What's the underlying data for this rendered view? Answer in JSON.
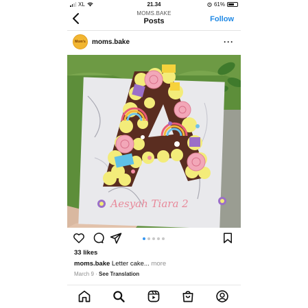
{
  "status_bar": {
    "carrier": "XL",
    "time": "21.34",
    "battery": "61%"
  },
  "header": {
    "subtitle": "MOMS.BAKE",
    "title": "Posts",
    "follow_label": "Follow"
  },
  "post": {
    "username": "moms.bake",
    "avatar_text": "Mom's",
    "cake_writing": "Aesyah Tiara 2",
    "likes": "33 likes",
    "caption_user": "moms.bake",
    "caption_text": "Letter cake...",
    "caption_more": "more",
    "date": "March 9",
    "separator": "·",
    "see_translation": "See Translation",
    "carousel": {
      "total": 5,
      "active": 1
    }
  },
  "tabs": [
    "home-icon",
    "search-icon",
    "reels-icon",
    "shop-icon",
    "profile-icon"
  ],
  "colors": {
    "accent": "#1e88e5",
    "cake_text": "#e8899a",
    "frosting": "#f3ec7a"
  }
}
